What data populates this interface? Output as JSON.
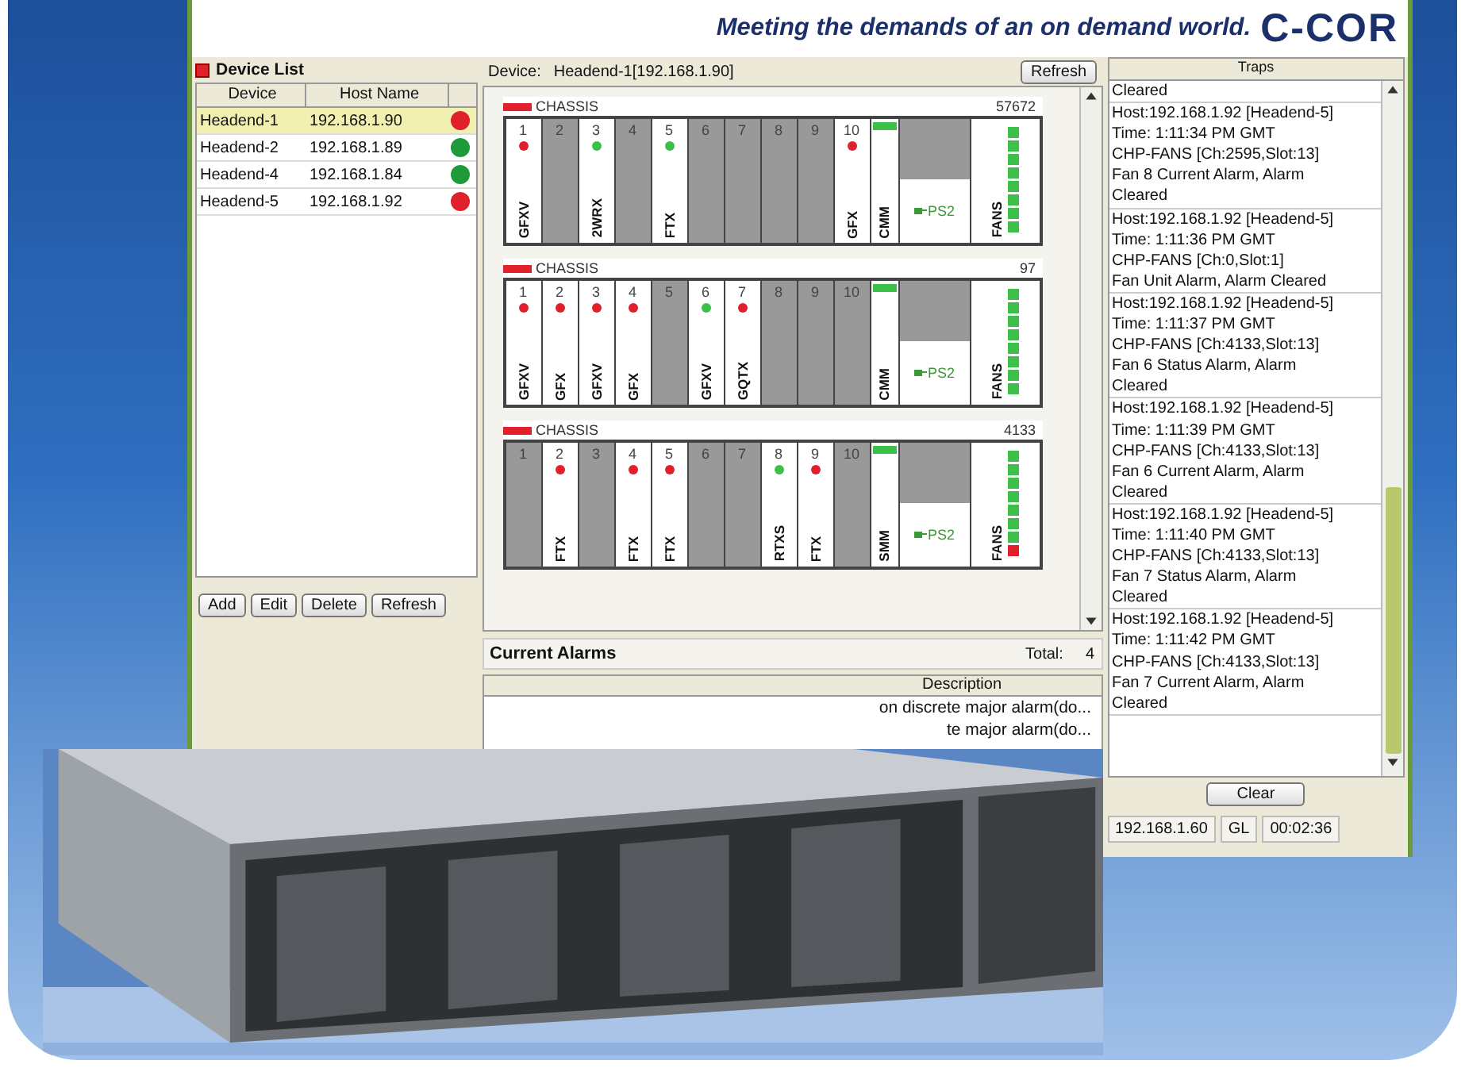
{
  "banner": {
    "tagline": "Meeting the demands of an on demand world.",
    "logo": "C-COR"
  },
  "device_list": {
    "title": "Device List",
    "columns": [
      "Device",
      "Host Name"
    ],
    "rows": [
      {
        "device": "Headend-1",
        "host": "192.168.1.90",
        "selected": true,
        "color": "#e0202a"
      },
      {
        "device": "Headend-2",
        "host": "192.168.1.89",
        "selected": false,
        "color": "#1f9a3a"
      },
      {
        "device": "Headend-4",
        "host": "192.168.1.84",
        "selected": false,
        "color": "#1f9a3a"
      },
      {
        "device": "Headend-5",
        "host": "192.168.1.92",
        "selected": false,
        "color": "#e0202a"
      }
    ],
    "buttons": [
      "Add",
      "Edit",
      "Delete",
      "Refresh"
    ]
  },
  "device_view": {
    "label": "Device:",
    "device": "Headend-1[192.168.1.90]",
    "refresh_button": "Refresh",
    "chassis": [
      {
        "title": "CHASSIS",
        "number": "57672",
        "color": "#e0202a",
        "slots": [
          {
            "number": "1",
            "kind": "card",
            "label": "GFXV",
            "color": "#e0202a"
          },
          {
            "number": "2",
            "kind": "empty"
          },
          {
            "number": "3",
            "kind": "card",
            "label": "2WRX",
            "color": "#3cc04a"
          },
          {
            "number": "4",
            "kind": "empty"
          },
          {
            "number": "5",
            "kind": "card",
            "label": "FTX",
            "color": "#3cc04a"
          },
          {
            "number": "6",
            "kind": "empty"
          },
          {
            "number": "7",
            "kind": "empty"
          },
          {
            "number": "8",
            "kind": "empty"
          },
          {
            "number": "9",
            "kind": "empty"
          },
          {
            "number": "10",
            "kind": "card",
            "label": "GFX",
            "color": "#e0202a"
          }
        ],
        "controller": {
          "label": "CMM",
          "color": "#3cc04a"
        },
        "power": "PS2",
        "fans": {
          "label": "FANS",
          "alarm": false
        }
      },
      {
        "title": "CHASSIS",
        "number": "97",
        "color": "#e0202a",
        "slots": [
          {
            "number": "1",
            "kind": "card",
            "label": "GFXV",
            "color": "#e0202a"
          },
          {
            "number": "2",
            "kind": "card",
            "label": "GFX",
            "color": "#e0202a"
          },
          {
            "number": "3",
            "kind": "card",
            "label": "GFXV",
            "color": "#e0202a"
          },
          {
            "number": "4",
            "kind": "card",
            "label": "GFX",
            "color": "#e0202a"
          },
          {
            "number": "5",
            "kind": "empty"
          },
          {
            "number": "6",
            "kind": "card",
            "label": "GFXV",
            "color": "#3cc04a"
          },
          {
            "number": "7",
            "kind": "card",
            "label": "GQTX",
            "color": "#e0202a"
          },
          {
            "number": "8",
            "kind": "empty"
          },
          {
            "number": "9",
            "kind": "empty"
          },
          {
            "number": "10",
            "kind": "empty"
          }
        ],
        "controller": {
          "label": "CMM",
          "color": "#3cc04a"
        },
        "power": "PS2",
        "fans": {
          "label": "FANS",
          "alarm": false
        }
      },
      {
        "title": "CHASSIS",
        "number": "4133",
        "color": "#e0202a",
        "slots": [
          {
            "number": "1",
            "kind": "empty"
          },
          {
            "number": "2",
            "kind": "card",
            "label": "FTX",
            "color": "#e0202a"
          },
          {
            "number": "3",
            "kind": "empty"
          },
          {
            "number": "4",
            "kind": "card",
            "label": "FTX",
            "color": "#e0202a"
          },
          {
            "number": "5",
            "kind": "card",
            "label": "FTX",
            "color": "#e0202a"
          },
          {
            "number": "6",
            "kind": "empty"
          },
          {
            "number": "7",
            "kind": "empty"
          },
          {
            "number": "8",
            "kind": "card",
            "label": "RTXS",
            "color": "#3cc04a"
          },
          {
            "number": "9",
            "kind": "card",
            "label": "FTX",
            "color": "#e0202a"
          },
          {
            "number": "10",
            "kind": "empty"
          }
        ],
        "controller": {
          "label": "SMM",
          "color": "#3cc04a"
        },
        "power": "PS2",
        "fans": {
          "label": "FANS",
          "alarm": true
        }
      }
    ]
  },
  "current_alarms": {
    "title": "Current Alarms",
    "total_label": "Total:",
    "total": "4",
    "column": "Description",
    "rows": [
      "on discrete major alarm(do...",
      "te major alarm(do..."
    ]
  },
  "traps": {
    "title": "Traps",
    "entries": [
      [
        "Cleared"
      ],
      [
        "Host:192.168.1.92 [Headend-5]",
        "Time: 1:11:34 PM GMT",
        "CHP-FANS [Ch:2595,Slot:13]",
        "Fan 8 Current Alarm, Alarm",
        "Cleared"
      ],
      [
        "Host:192.168.1.92 [Headend-5]",
        "Time: 1:11:36 PM GMT",
        "CHP-FANS [Ch:0,Slot:1]",
        "Fan Unit Alarm, Alarm Cleared"
      ],
      [
        "Host:192.168.1.92 [Headend-5]",
        "Time: 1:11:37 PM GMT",
        "CHP-FANS [Ch:4133,Slot:13]",
        "Fan 6 Status Alarm, Alarm",
        "Cleared"
      ],
      [
        "Host:192.168.1.92 [Headend-5]",
        "Time: 1:11:39 PM GMT",
        "CHP-FANS [Ch:4133,Slot:13]",
        "Fan 6 Current Alarm, Alarm",
        "Cleared"
      ],
      [
        "Host:192.168.1.92 [Headend-5]",
        "Time: 1:11:40 PM GMT",
        "CHP-FANS [Ch:4133,Slot:13]",
        "Fan 7 Status Alarm, Alarm",
        "Cleared"
      ],
      [
        "Host:192.168.1.92 [Headend-5]",
        "Time: 1:11:42 PM GMT",
        "CHP-FANS [Ch:4133,Slot:13]",
        "Fan 7 Current Alarm, Alarm",
        "Cleared"
      ]
    ],
    "clear_button": "Clear"
  },
  "status_bar": [
    "192.168.1.60",
    "GL",
    "00:02:36"
  ]
}
